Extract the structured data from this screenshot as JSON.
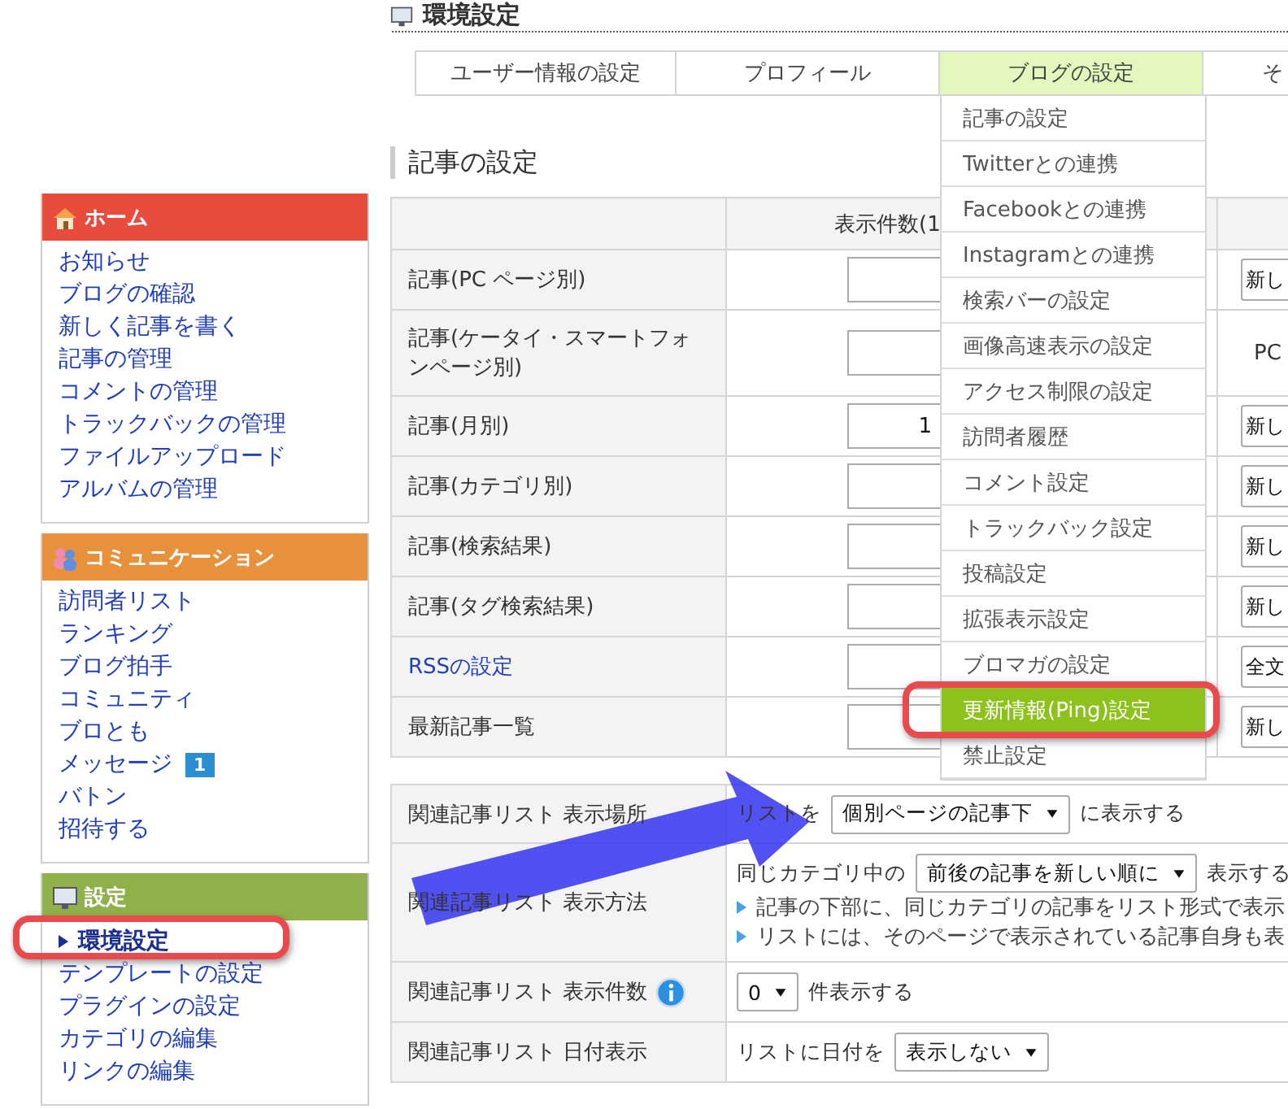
{
  "page_title": "環境設定",
  "sidebar": {
    "sections": [
      {
        "kind": "home",
        "title": "ホーム",
        "color": "#e84c3d",
        "items": [
          {
            "label": "お知らせ",
            "selected": false
          },
          {
            "label": "ブログの確認",
            "selected": false
          },
          {
            "label": "新しく記事を書く",
            "selected": false
          },
          {
            "label": "記事の管理",
            "selected": false
          },
          {
            "label": "コメントの管理",
            "selected": false
          },
          {
            "label": "トラックバックの管理",
            "selected": false
          },
          {
            "label": "ファイルアップロード",
            "selected": false
          },
          {
            "label": "アルバムの管理",
            "selected": false
          }
        ]
      },
      {
        "kind": "people",
        "title": "コミュニケーション",
        "color": "#e8913c",
        "items": [
          {
            "label": "訪問者リスト",
            "selected": false
          },
          {
            "label": "ランキング",
            "selected": false
          },
          {
            "label": "ブログ拍手",
            "selected": false
          },
          {
            "label": "コミュニティ",
            "selected": false
          },
          {
            "label": "ブロとも",
            "selected": false
          },
          {
            "label": "メッセージ",
            "selected": false,
            "badge": "1"
          },
          {
            "label": "バトン",
            "selected": false
          },
          {
            "label": "招待する",
            "selected": false
          }
        ]
      },
      {
        "kind": "settings",
        "title": "設定",
        "color": "#8fb04a",
        "items": [
          {
            "label": "環境設定",
            "selected": true
          },
          {
            "label": "テンプレートの設定",
            "selected": false
          },
          {
            "label": "プラグインの設定",
            "selected": false
          },
          {
            "label": "カテゴリの編集",
            "selected": false
          },
          {
            "label": "リンクの編集",
            "selected": false
          }
        ]
      }
    ]
  },
  "tabs": [
    {
      "label": "ユーザー情報の設定",
      "selected": false
    },
    {
      "label": "プロフィール",
      "selected": false
    },
    {
      "label": "ブログの設定",
      "selected": true
    },
    {
      "label": "そ",
      "selected": false
    }
  ],
  "tab_menu": {
    "items": [
      {
        "label": "記事の設定",
        "selected": false
      },
      {
        "label": "Twitterとの連携",
        "selected": false
      },
      {
        "label": "Facebookとの連携",
        "selected": false
      },
      {
        "label": "Instagramとの連携",
        "selected": false
      },
      {
        "label": "検索バーの設定",
        "selected": false
      },
      {
        "label": "画像高速表示の設定",
        "selected": false
      },
      {
        "label": "アクセス制限の設定",
        "selected": false
      },
      {
        "label": "訪問者履歴",
        "selected": false
      },
      {
        "label": "コメント設定",
        "selected": false
      },
      {
        "label": "トラックバック設定",
        "selected": false
      },
      {
        "label": "投稿設定",
        "selected": false
      },
      {
        "label": "拡張表示設定",
        "selected": false
      },
      {
        "label": "ブロマガの設定",
        "selected": false
      },
      {
        "label": "更新情報(Ping)設定",
        "selected": true
      },
      {
        "label": "禁止設定",
        "selected": false
      }
    ]
  },
  "section_heading": "記事の設定",
  "article_table": {
    "columns": [
      "表示件数(1"
    ],
    "rows": [
      {
        "label": "記事(PC ページ別)",
        "link": false,
        "column_3": {
          "kind": "select",
          "text": "新し"
        }
      },
      {
        "label": "記事(ケータイ・スマートフォンページ別)",
        "link": false,
        "column_3": {
          "kind": "text",
          "text": "PC"
        }
      },
      {
        "label": "記事(月別)",
        "link": false,
        "value": "1",
        "column_3": {
          "kind": "select",
          "text": "新し"
        }
      },
      {
        "label": "記事(カテゴリ別)",
        "link": false,
        "column_3": {
          "kind": "select",
          "text": "新し"
        }
      },
      {
        "label": "記事(検索結果)",
        "link": false,
        "column_3": {
          "kind": "select",
          "text": "新し"
        }
      },
      {
        "label": "記事(タグ検索結果)",
        "link": false,
        "column_3": {
          "kind": "select",
          "text": "新し"
        }
      },
      {
        "label": "RSSの設定",
        "link": true,
        "column_3": {
          "kind": "select",
          "text": "全文"
        }
      },
      {
        "label": "最新記事一覧",
        "link": false,
        "column_3": {
          "kind": "select",
          "text": "新し"
        }
      }
    ]
  },
  "related_table": {
    "rows": [
      {
        "label": "関連記事リスト 表示場所",
        "info": false,
        "parts": [
          {
            "kind": "text",
            "text": "リストを"
          },
          {
            "kind": "select",
            "text": "個別ページの記事下"
          },
          {
            "kind": "text",
            "text": "に表示する"
          }
        ]
      },
      {
        "label": "関連記事リスト 表示方法",
        "info": false,
        "parts": [
          {
            "kind": "text",
            "text": "同じカテゴリ中の"
          },
          {
            "kind": "select",
            "text": "前後の記事を新しい順に"
          },
          {
            "kind": "text",
            "text": "表示する"
          }
        ],
        "notes": [
          "記事の下部に、同じカテゴリの記事をリスト形式で表示",
          "リストには、そのページで表示されている記事自身も表"
        ]
      },
      {
        "label": "関連記事リスト 表示件数",
        "info": true,
        "parts": [
          {
            "kind": "select",
            "text": "0"
          },
          {
            "kind": "text",
            "text": "件表示する"
          }
        ]
      },
      {
        "label": "関連記事リスト 日付表示",
        "info": false,
        "parts": [
          {
            "kind": "text",
            "text": "リストに日付を"
          },
          {
            "kind": "select",
            "text": "表示しない"
          }
        ]
      }
    ]
  },
  "annotations": [
    {
      "kind": "sidebar-highlight"
    },
    {
      "kind": "menu-highlight"
    },
    {
      "kind": "arrow"
    }
  ]
}
